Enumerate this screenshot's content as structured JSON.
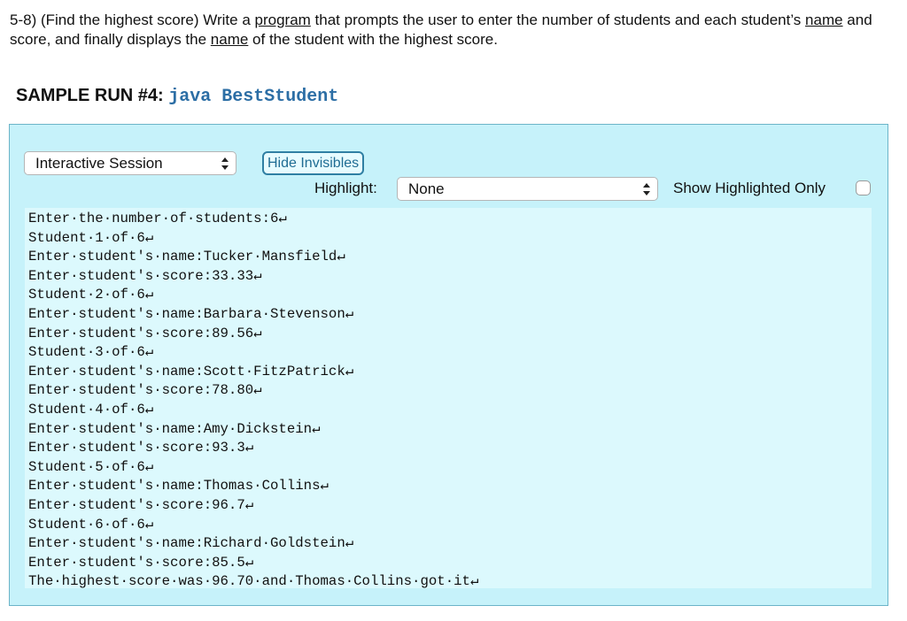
{
  "problem": {
    "prefix": "5-8) (Find the highest score) Write a ",
    "link_program": "program",
    "middle": " that prompts the user to enter the number of students and each student’s ",
    "link_name1": "name",
    "middle2": " and score, and finally displays the ",
    "link_name2": "name",
    "suffix": " of the student with the highest score."
  },
  "sample_run": {
    "label": "SAMPLE RUN #4: ",
    "command": "java BestStudent"
  },
  "controls": {
    "session_select_value": "Interactive Session",
    "hide_invisibles_label": "Hide Invisibles",
    "highlight_label": "Highlight:",
    "highlight_select_value": "None",
    "show_highlighted_only_label": "Show Highlighted Only"
  },
  "transcript": {
    "lines": [
      "Enter·the·number·of·students:6↵",
      "Student·1·of·6↵",
      "Enter·student's·name:Tucker·Mansfield↵",
      "Enter·student's·score:33.33↵",
      "Student·2·of·6↵",
      "Enter·student's·name:Barbara·Stevenson↵",
      "Enter·student's·score:89.56↵",
      "Student·3·of·6↵",
      "Enter·student's·name:Scott·FitzPatrick↵",
      "Enter·student's·score:78.80↵",
      "Student·4·of·6↵",
      "Enter·student's·name:Amy·Dickstein↵",
      "Enter·student's·score:93.3↵",
      "Student·5·of·6↵",
      "Enter·student's·name:Thomas·Collins↵",
      "Enter·student's·score:96.7↵",
      "Student·6·of·6↵",
      "Enter·student's·name:Richard·Goldstein↵",
      "Enter·student's·score:85.5↵",
      "The·highest·score·was·96.70·and·Thomas·Collins·got·it↵"
    ]
  },
  "colors": {
    "panel_background": "#c6f2fa",
    "transcript_background": "#dcf9fd",
    "command_text": "#2c6ea5",
    "button_border": "#2f7fa3"
  }
}
